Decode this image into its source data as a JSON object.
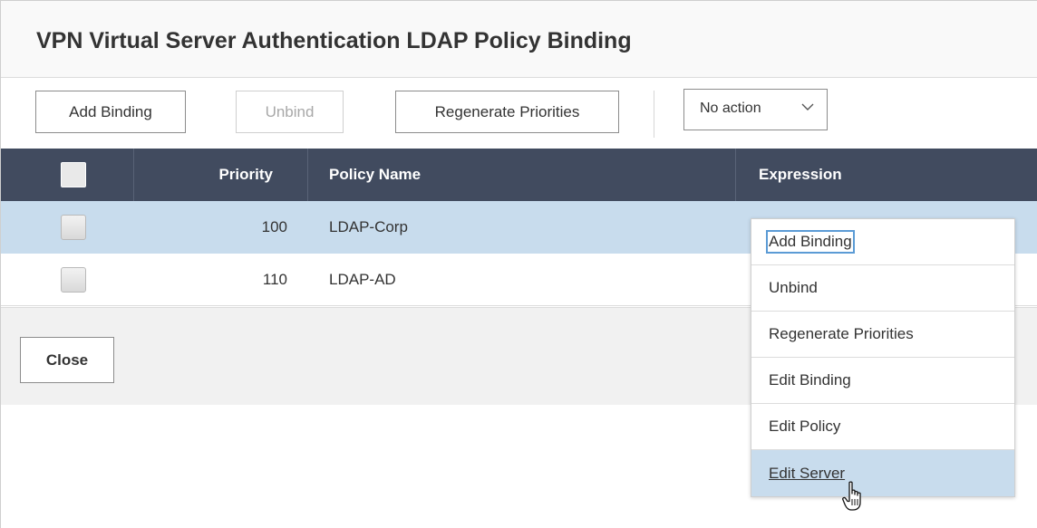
{
  "dialog": {
    "title": "VPN Virtual Server Authentication LDAP Policy Binding"
  },
  "toolbar": {
    "add_binding_label": "Add Binding",
    "unbind_label": "Unbind",
    "regenerate_label": "Regenerate Priorities",
    "action_select_value": "No action"
  },
  "table": {
    "columns": {
      "priority": "Priority",
      "policy_name": "Policy Name",
      "expression": "Expression"
    },
    "rows": [
      {
        "priority": "100",
        "policy_name": "LDAP-Corp",
        "selected": true
      },
      {
        "priority": "110",
        "policy_name": "LDAP-AD",
        "selected": false
      }
    ]
  },
  "footer": {
    "close_label": "Close"
  },
  "context_menu": {
    "items": [
      {
        "label": "Add Binding"
      },
      {
        "label": "Unbind"
      },
      {
        "label": "Regenerate Priorities"
      },
      {
        "label": "Edit Binding"
      },
      {
        "label": "Edit Policy"
      },
      {
        "label": "Edit Server"
      }
    ]
  },
  "colors": {
    "header_bg": "#414b5f",
    "selected_row_bg": "#c8dced",
    "footer_bg": "#f1f1f1",
    "title_bar_bg": "#f9f9f9"
  }
}
